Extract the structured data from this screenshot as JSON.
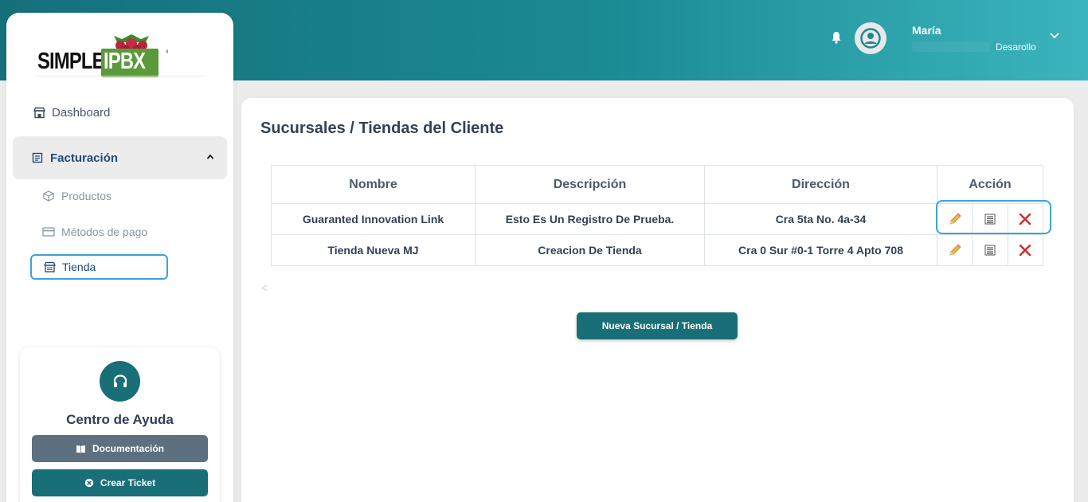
{
  "header": {
    "user_name": "María",
    "user_role": "Desarollo",
    "icons": [
      "bell-icon",
      "user-avatar-icon",
      "chevron-down-icon"
    ]
  },
  "logo": {
    "part_a": "SIMPLE",
    "part_b": "IPBX",
    "mark": "³"
  },
  "sidebar": {
    "items": [
      {
        "label": "Dashboard",
        "icon": "store-icon"
      },
      {
        "label": "Facturación",
        "icon": "invoice-icon",
        "expanded": true
      },
      {
        "label": "Productos",
        "icon": "box-icon"
      },
      {
        "label": "Métodos de pago",
        "icon": "credit-card-icon"
      },
      {
        "label": "Tienda",
        "icon": "shop-icon",
        "active": true
      }
    ]
  },
  "help": {
    "title": "Centro de Ayuda",
    "docs_label": "Documentación",
    "ticket_label": "Crear Ticket"
  },
  "main": {
    "title": "Sucursales / Tiendas del Cliente",
    "columns": [
      "Nombre",
      "Descripción",
      "Dirección",
      "Acción"
    ],
    "rows": [
      {
        "nombre": "Guaranted Innovation Link",
        "descripcion": "Esto Es Un Registro De Prueba.",
        "direccion": "Cra 5ta No. 4a-34"
      },
      {
        "nombre": "Tienda Nueva MJ",
        "descripcion": "Creacion De Tienda",
        "direccion": "Cra 0 Sur #0-1 Torre 4 Apto 708"
      }
    ],
    "pager_prev": "<",
    "new_button": "Nueva Sucursal / Tienda"
  },
  "colors": {
    "teal": "#186f77",
    "highlight": "#3aa3e0",
    "nav_active": "#1e4a80"
  }
}
